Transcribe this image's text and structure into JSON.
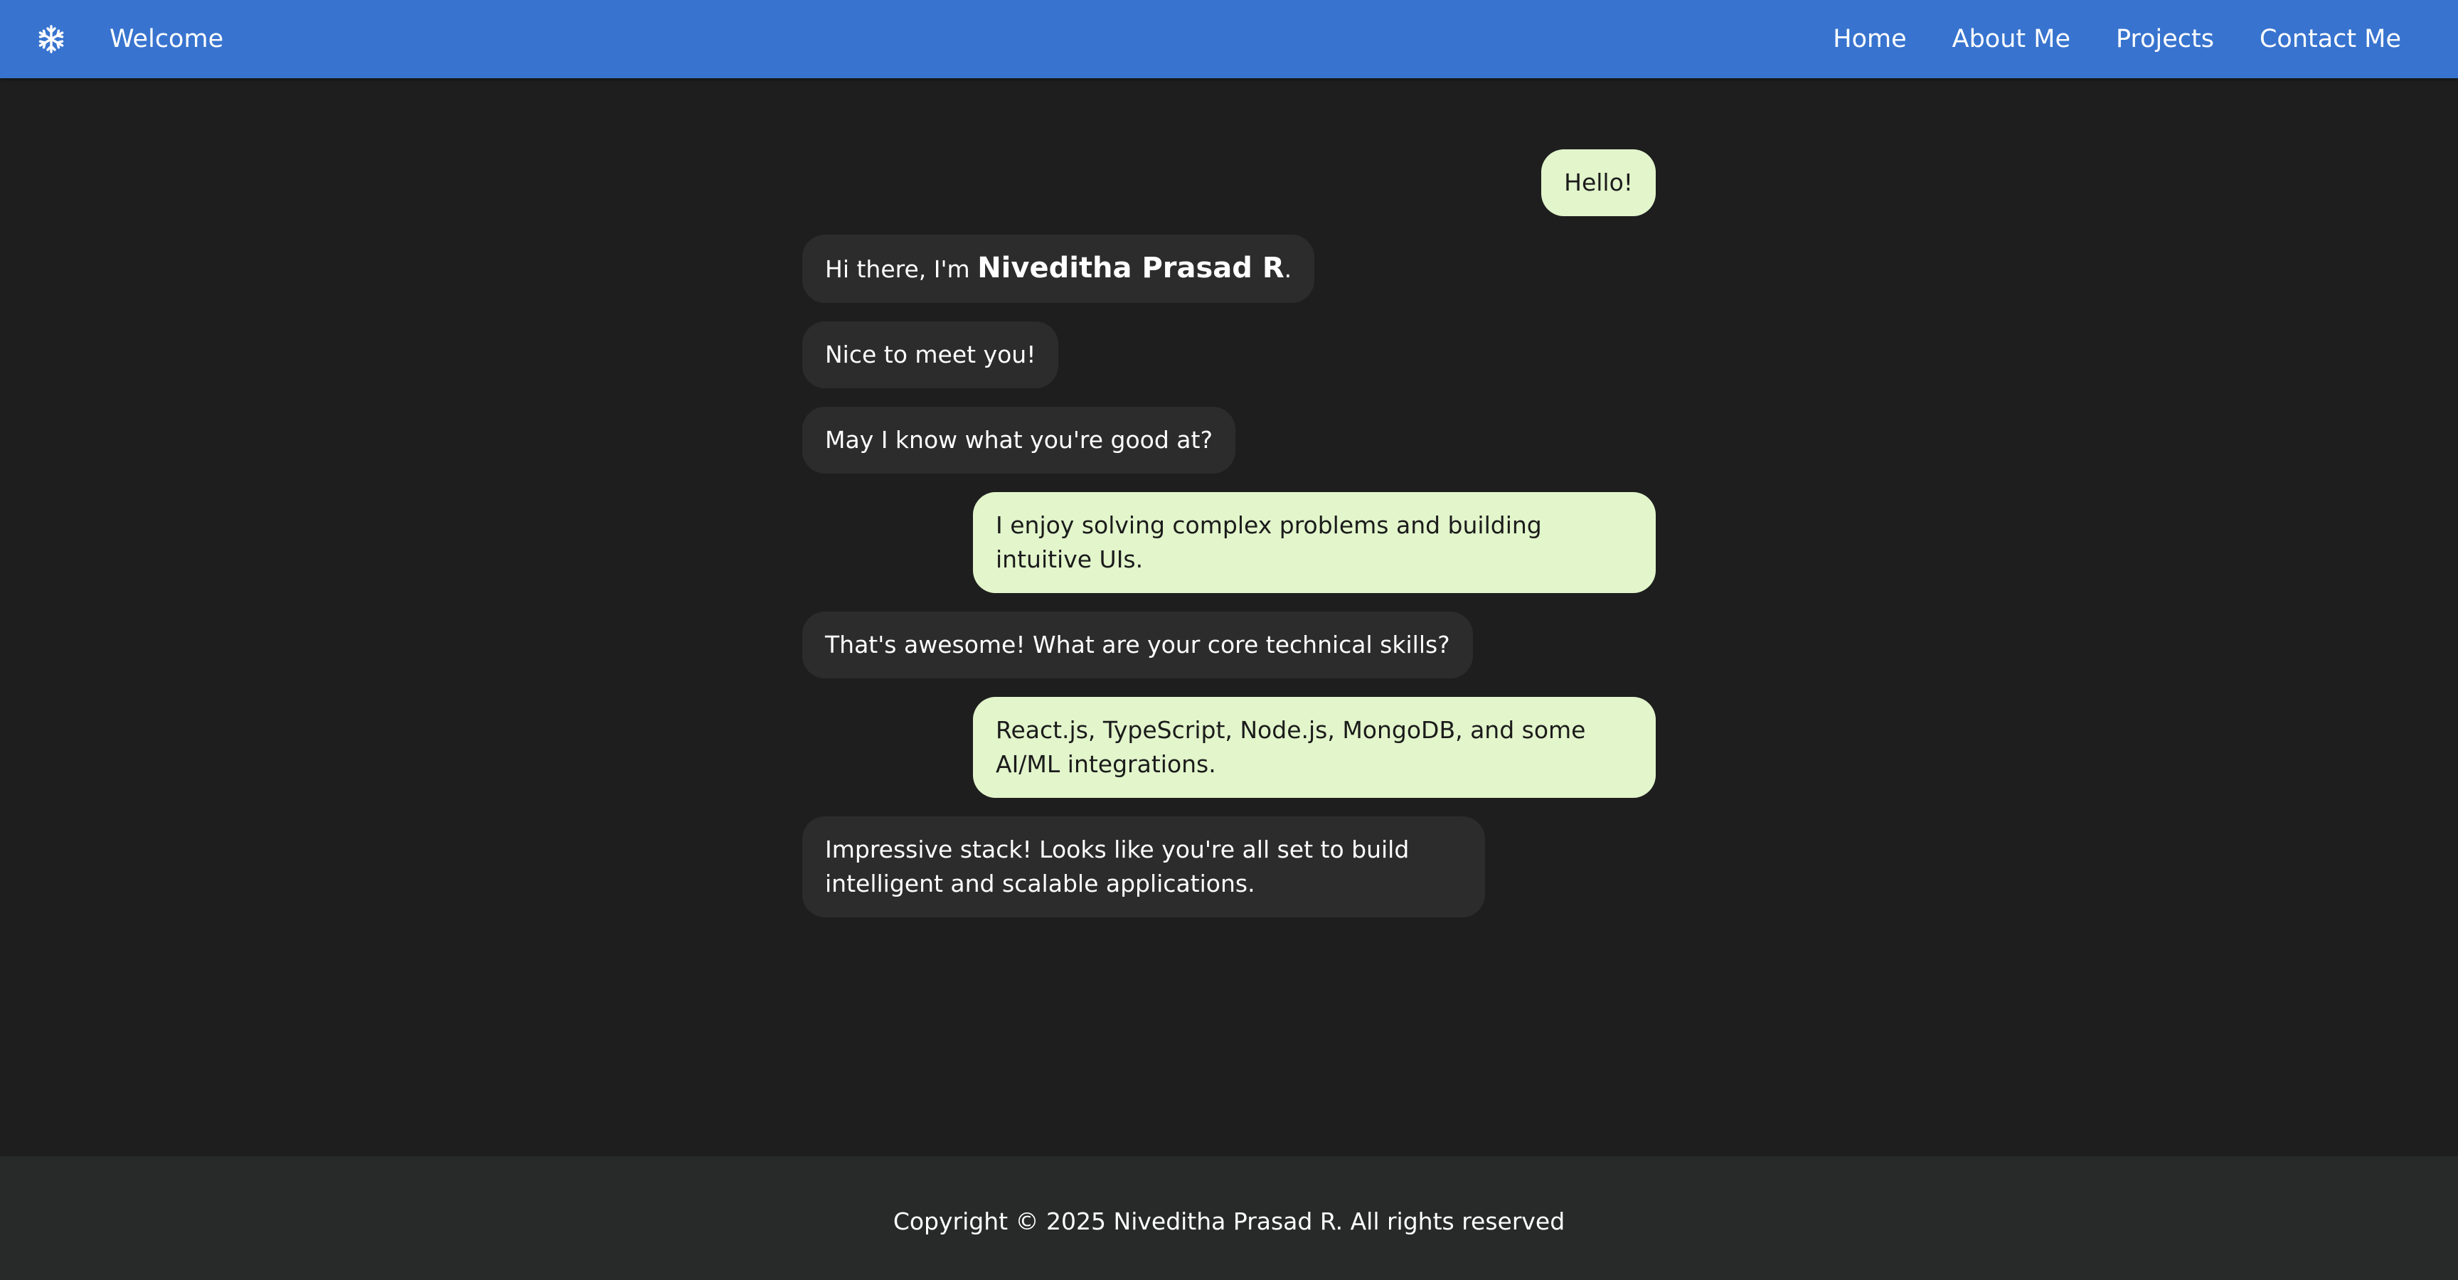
{
  "colors": {
    "navbar": "#3874cf",
    "background": "#1e1e1e",
    "bot_bubble": "#2c2c2c",
    "user_bubble": "#e2f5cb",
    "footer": "#282a2a"
  },
  "navbar": {
    "icon": "snowflake-icon",
    "title": "Welcome",
    "links": [
      "Home",
      "About Me",
      "Projects",
      "Contact Me"
    ]
  },
  "chat": {
    "messages": [
      {
        "sender": "user",
        "text": "Hello!"
      },
      {
        "sender": "bot",
        "prefix": "Hi there, I'm ",
        "name": "Niveditha Prasad R",
        "suffix": "."
      },
      {
        "sender": "bot",
        "text": "Nice to meet you!"
      },
      {
        "sender": "bot",
        "text": "May I know what you're good at?"
      },
      {
        "sender": "user",
        "text": "I enjoy solving complex problems and building intuitive UIs."
      },
      {
        "sender": "bot",
        "text": "That's awesome! What are your core technical skills?"
      },
      {
        "sender": "user",
        "text": "React.js, TypeScript, Node.js, MongoDB, and some AI/ML integrations."
      },
      {
        "sender": "bot",
        "text": "Impressive stack! Looks like you're all set to build intelligent and scalable applications."
      }
    ]
  },
  "footer": {
    "text": "Copyright © 2025 Niveditha Prasad R. All rights reserved"
  }
}
